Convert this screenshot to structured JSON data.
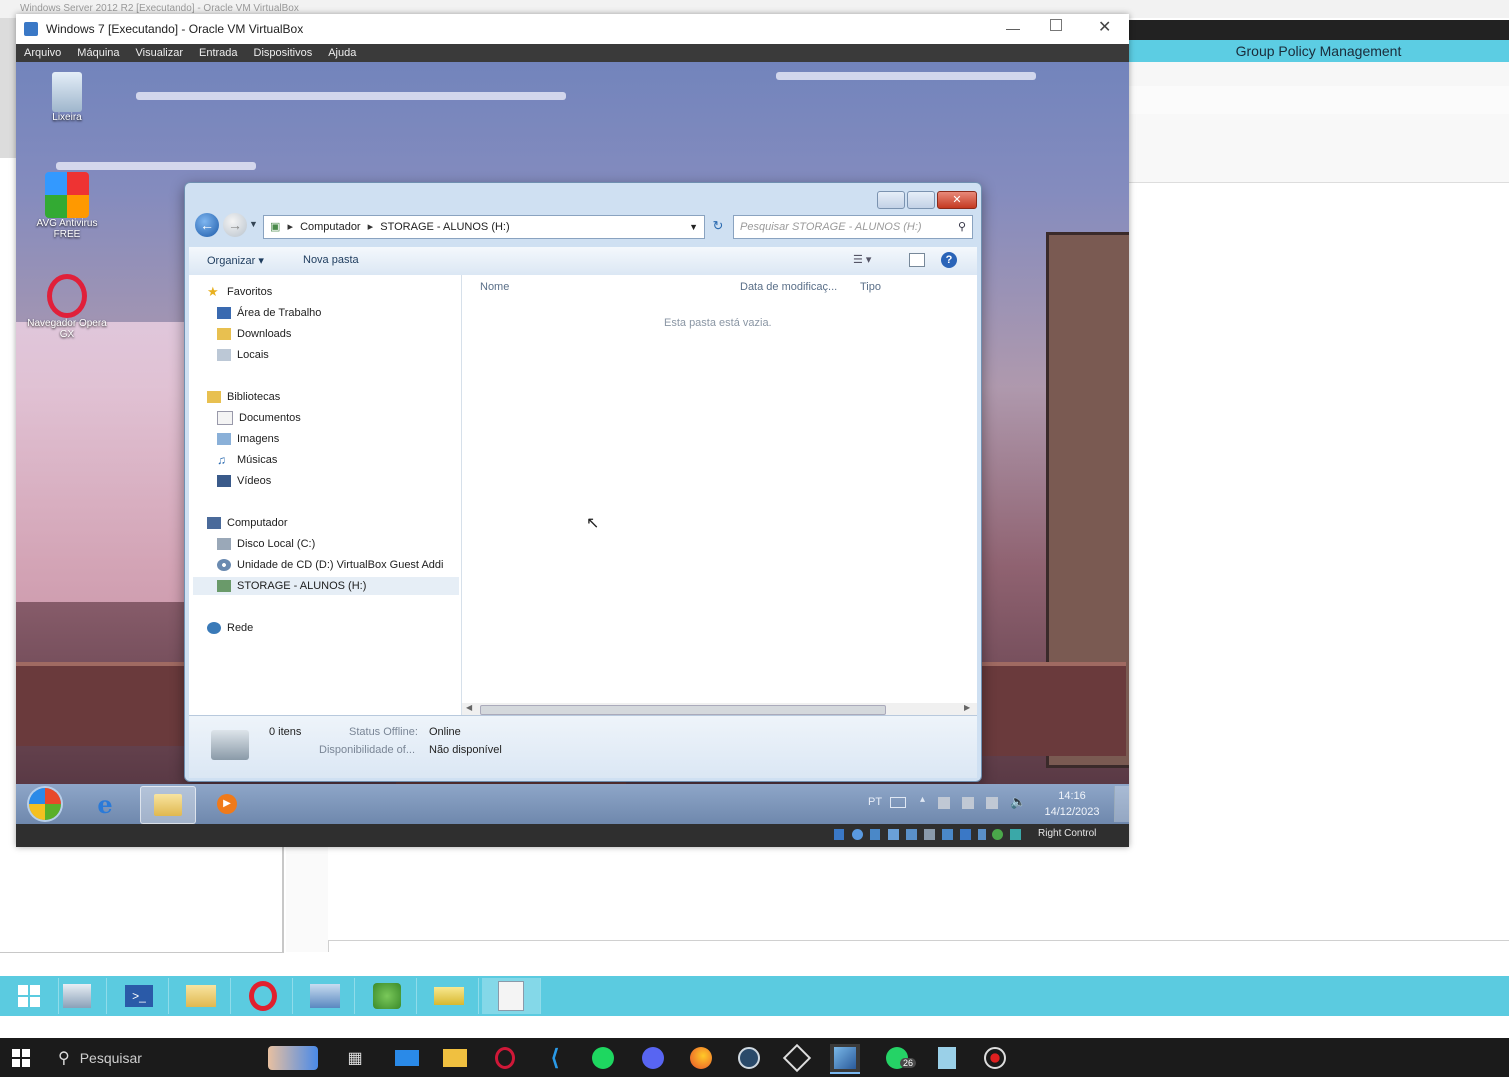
{
  "host": {
    "top_title": "Windows Server 2012 R2 [Executando] - Oracle VM VirtualBox",
    "gpm_title": "Group Policy Management",
    "server_taskbar_icons": [
      "windows-logo-icon",
      "server-manager-icon",
      "powershell-icon",
      "file-explorer-icon",
      "opera-icon",
      "remote-desktop-icon",
      "recycle-icon",
      "mail-icon",
      "notepad-icon"
    ],
    "win10_taskbar": {
      "search_label": "Pesquisar",
      "badge": "26",
      "icons": [
        "start-icon",
        "search-icon",
        "news-icon",
        "task-view-icon",
        "mail-icon",
        "file-explorer-icon",
        "opera-gx-icon",
        "vscode-icon",
        "spotify-icon",
        "discord-icon",
        "firefox-icon",
        "steam-icon",
        "cube-icon",
        "virtualbox-icon",
        "whatsapp-icon",
        "notepad-icon",
        "recorder-icon"
      ]
    }
  },
  "vbox": {
    "title": "Windows 7 [Executando] - Oracle VM VirtualBox",
    "menu": [
      "Arquivo",
      "Máquina",
      "Visualizar",
      "Entrada",
      "Dispositivos",
      "Ajuda"
    ],
    "statusbar_right": "Right Control"
  },
  "guest": {
    "desktop_icons": [
      {
        "label": "Lixeira",
        "icon": "recycle-bin-icon"
      },
      {
        "label": "AVG Antivirus FREE",
        "icon": "avg-icon"
      },
      {
        "label": "Navegador Opera GX",
        "icon": "opera-icon"
      }
    ],
    "taskbar": {
      "lang": "PT",
      "time": "14:16",
      "date": "14/12/2023"
    }
  },
  "explorer": {
    "breadcrumb": [
      "Computador",
      "STORAGE - ALUNOS (H:)"
    ],
    "search_placeholder": "Pesquisar STORAGE - ALUNOS (H:)",
    "cmd": {
      "organize": "Organizar",
      "new_folder": "Nova pasta"
    },
    "nav": {
      "favorites_header": "Favoritos",
      "favorites": [
        "Área de Trabalho",
        "Downloads",
        "Locais"
      ],
      "libraries_header": "Bibliotecas",
      "libraries": [
        "Documentos",
        "Imagens",
        "Músicas",
        "Vídeos"
      ],
      "computer_header": "Computador",
      "drives": [
        "Disco Local (C:)",
        "Unidade de CD (D:) VirtualBox Guest Addi",
        "STORAGE - ALUNOS (H:)"
      ],
      "network": "Rede"
    },
    "columns": [
      "Nome",
      "Data de modificaç...",
      "Tipo"
    ],
    "empty_message": "Esta pasta está vazia.",
    "details": {
      "items": "0 itens",
      "status_label": "Status Offline:",
      "status_value": "Online",
      "availability_label": "Disponibilidade of...",
      "availability_value": "Não disponível"
    }
  },
  "colors": {
    "server_taskbar": "#5bcbe0",
    "win10_taskbar": "#1b1b1b",
    "gpm_header": "#5ccde3"
  }
}
